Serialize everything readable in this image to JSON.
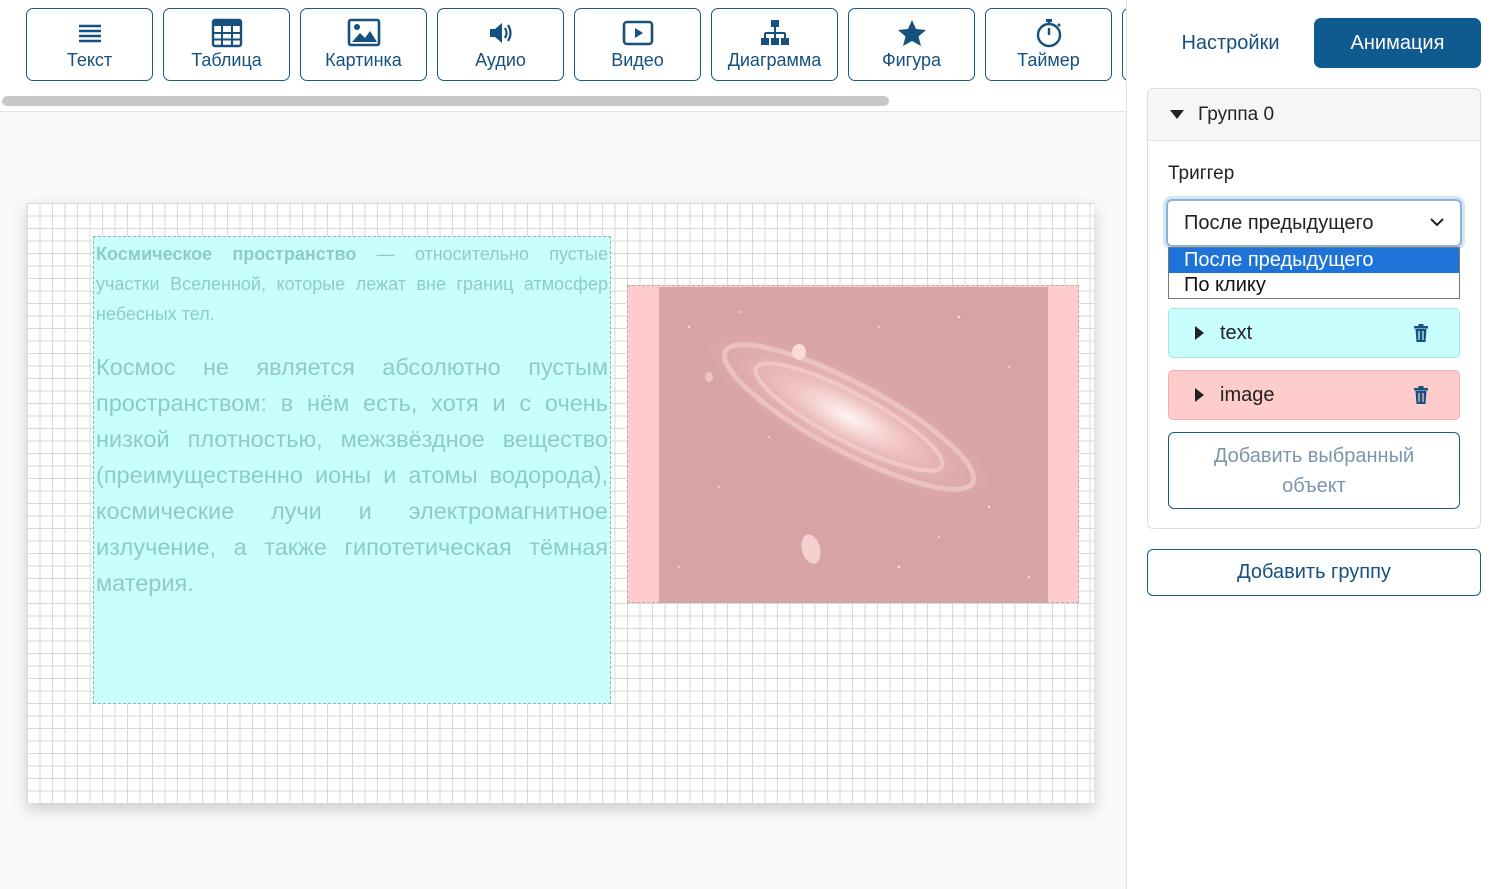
{
  "toolbar": {
    "buttons": [
      {
        "label": "Текст",
        "icon": "text-lines-icon"
      },
      {
        "label": "Таблица",
        "icon": "table-icon"
      },
      {
        "label": "Картинка",
        "icon": "image-icon"
      },
      {
        "label": "Аудио",
        "icon": "speaker-icon"
      },
      {
        "label": "Видео",
        "icon": "video-play-icon"
      },
      {
        "label": "Диаграмма",
        "icon": "hierarchy-icon"
      },
      {
        "label": "Фигура",
        "icon": "star-icon"
      },
      {
        "label": "Таймер",
        "icon": "stopwatch-icon"
      }
    ]
  },
  "slide": {
    "text_block": {
      "p1_bold": "Космическое пространство",
      "p1_rest": " — относительно пустые участки Вселенной, которые лежат вне границ атмосфер небесных тел.",
      "p2": "Космос не является абсолютно пустым пространством: в нём есть, хотя и с очень низкой плотностью, межзвёздное вещество (преимущественно ионы и атомы водорода), космические лучи и электромагнитное излучение, а также гипотетическая тёмная материя."
    },
    "image_block": {
      "icon": "galaxy-image"
    }
  },
  "panel": {
    "tabs": {
      "settings": "Настройки",
      "animation": "Анимация"
    },
    "group": {
      "title": "Группа 0",
      "trigger_label": "Триггер",
      "trigger_value": "После предыдущего",
      "options": [
        "После предыдущего",
        "По клику"
      ],
      "objects": [
        {
          "label": "text",
          "color": "#c8fffe"
        },
        {
          "label": "image",
          "color": "#ffcccc"
        }
      ],
      "add_selected_line1": "Добавить выбранный",
      "add_selected_line2": "объект"
    },
    "add_group": "Добавить группу"
  },
  "colors": {
    "accent": "#0f5a8e",
    "text_highlight": "#c8fffe",
    "image_highlight": "#ffcccc",
    "dropdown_selected": "#1e73d8"
  }
}
